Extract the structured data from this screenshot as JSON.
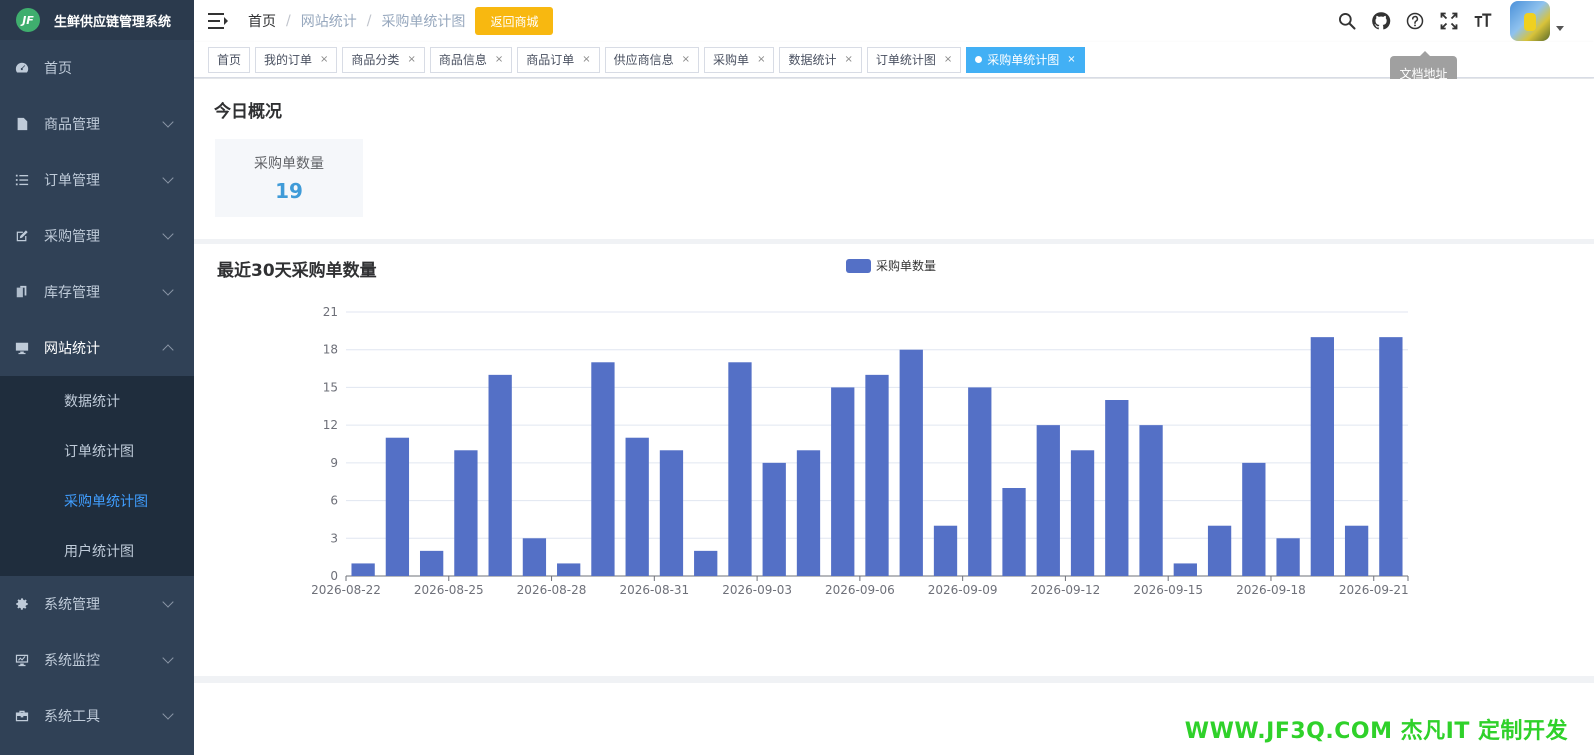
{
  "app": {
    "title": "生鲜供应链管理系统",
    "logo_text": "JF"
  },
  "sidebar": {
    "items": [
      {
        "label": "首页",
        "icon": "dashboard-icon",
        "has_arrow": false
      },
      {
        "label": "商品管理",
        "icon": "document-icon",
        "has_arrow": true
      },
      {
        "label": "订单管理",
        "icon": "list-icon",
        "has_arrow": true
      },
      {
        "label": "采购管理",
        "icon": "edit-icon",
        "has_arrow": true
      },
      {
        "label": "库存管理",
        "icon": "copy-icon",
        "has_arrow": true
      },
      {
        "label": "网站统计",
        "icon": "monitor-icon",
        "has_arrow": true,
        "open": true
      },
      {
        "label": "系统管理",
        "icon": "gear-icon",
        "has_arrow": true
      },
      {
        "label": "系统监控",
        "icon": "monitor-chart-icon",
        "has_arrow": true
      },
      {
        "label": "系统工具",
        "icon": "toolbox-icon",
        "has_arrow": true
      }
    ],
    "submenu": [
      {
        "label": "数据统计",
        "active": false
      },
      {
        "label": "订单统计图",
        "active": false
      },
      {
        "label": "采购单统计图",
        "active": true
      },
      {
        "label": "用户统计图",
        "active": false
      }
    ]
  },
  "navbar": {
    "breadcrumb": [
      "首页",
      "网站统计",
      "采购单统计图"
    ],
    "return_label": "返回商城",
    "tooltip": "文档地址",
    "icons": [
      "search-icon",
      "github-icon",
      "question-icon",
      "fullscreen-icon",
      "font-size-icon"
    ]
  },
  "tags": [
    {
      "label": "首页",
      "closable": false,
      "active": false
    },
    {
      "label": "我的订单",
      "closable": true,
      "active": false
    },
    {
      "label": "商品分类",
      "closable": true,
      "active": false
    },
    {
      "label": "商品信息",
      "closable": true,
      "active": false
    },
    {
      "label": "商品订单",
      "closable": true,
      "active": false
    },
    {
      "label": "供应商信息",
      "closable": true,
      "active": false
    },
    {
      "label": "采购单",
      "closable": true,
      "active": false
    },
    {
      "label": "数据统计",
      "closable": true,
      "active": false
    },
    {
      "label": "订单统计图",
      "closable": true,
      "active": false
    },
    {
      "label": "采购单统计图",
      "closable": true,
      "active": true
    }
  ],
  "overview": {
    "title": "今日概况",
    "stat_label": "采购单数量",
    "stat_value": "19"
  },
  "chart_section": {
    "title": "最近30天采购单数量",
    "legend": "采购单数量"
  },
  "chart_data": {
    "type": "bar",
    "categories": [
      "2026-08-22",
      "2026-08-23",
      "2026-08-24",
      "2026-08-25",
      "2026-08-26",
      "2026-08-27",
      "2026-08-28",
      "2026-08-29",
      "2026-08-30",
      "2026-08-31",
      "2026-09-01",
      "2026-09-02",
      "2026-09-03",
      "2026-09-04",
      "2026-09-05",
      "2026-09-06",
      "2026-09-07",
      "2026-09-08",
      "2026-09-09",
      "2026-09-10",
      "2026-09-11",
      "2026-09-12",
      "2026-09-13",
      "2026-09-14",
      "2026-09-15",
      "2026-09-16",
      "2026-09-17",
      "2026-09-18",
      "2026-09-19",
      "2026-09-20",
      "2026-09-21"
    ],
    "x_tick_labels": [
      "2026-08-22",
      "2026-08-25",
      "2026-08-28",
      "2026-08-31",
      "2026-09-03",
      "2026-09-06",
      "2026-09-09",
      "2026-09-12",
      "2026-09-15",
      "2026-09-18",
      "2026-09-21"
    ],
    "series": [
      {
        "name": "采购单数量",
        "values": [
          1,
          11,
          2,
          10,
          16,
          3,
          1,
          17,
          11,
          10,
          2,
          17,
          9,
          10,
          15,
          16,
          18,
          4,
          15,
          7,
          12,
          10,
          14,
          12,
          1,
          4,
          9,
          3,
          19,
          4,
          19
        ]
      }
    ],
    "ylim": [
      0,
      21
    ],
    "yticks": [
      0,
      3,
      6,
      9,
      12,
      15,
      18,
      21
    ],
    "color": "#5470c6",
    "grid": true
  },
  "watermark": "WWW.JF3Q.COM 杰凡IT  定制开发"
}
